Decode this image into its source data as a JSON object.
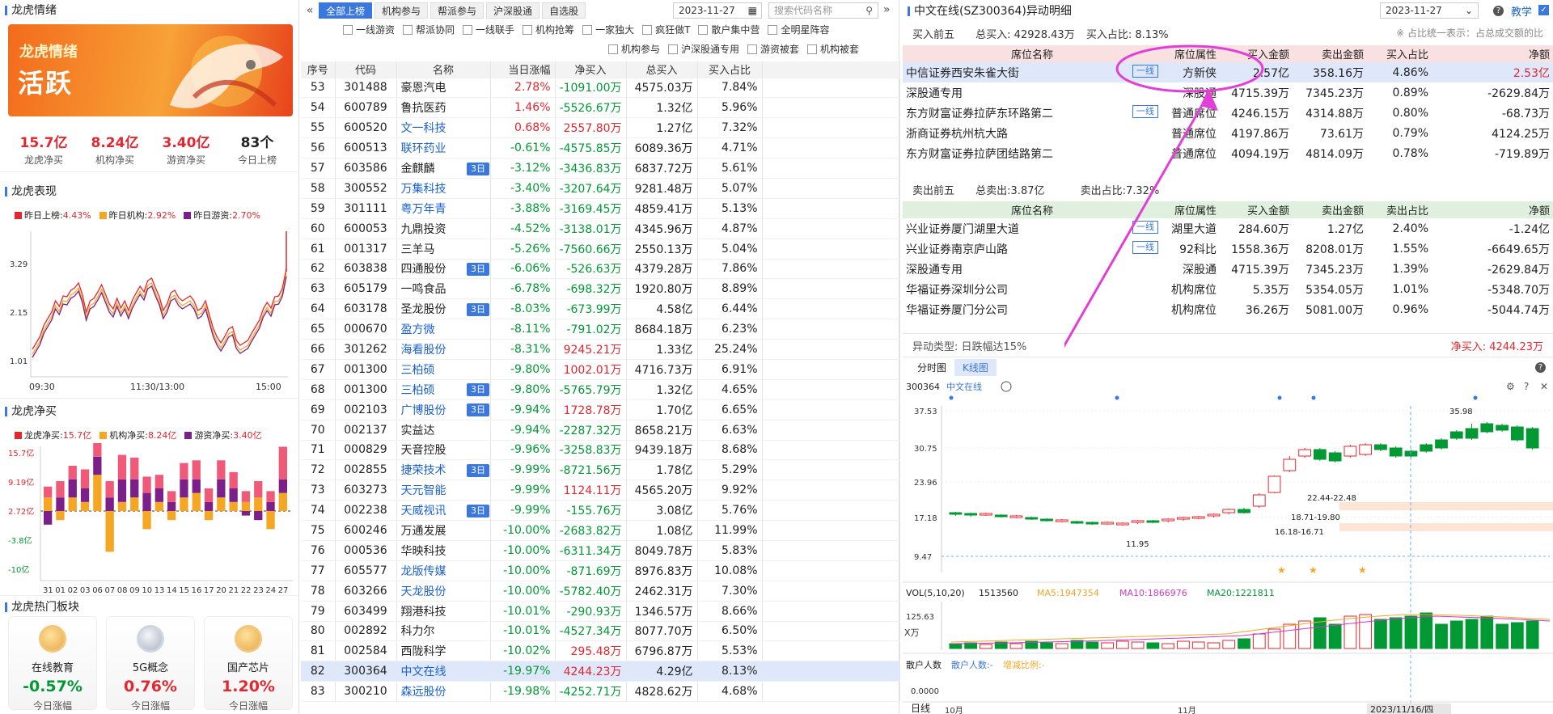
{
  "left": {
    "title": "龙虎情绪",
    "banner_t1": "龙虎情绪",
    "banner_t2": "活跃",
    "stats": [
      {
        "v": "15.7亿",
        "l": "龙虎净买",
        "c": "red"
      },
      {
        "v": "8.24亿",
        "l": "机构净买",
        "c": "red"
      },
      {
        "v": "3.40亿",
        "l": "游资净买",
        "c": "red"
      },
      {
        "v": "83个",
        "l": "今日上榜",
        "c": "dark"
      }
    ],
    "perf_title": "龙虎表现",
    "perf_legend": [
      {
        "n": "昨日上榜:",
        "v": "4.43%",
        "c": "#e4262e"
      },
      {
        "n": "昨日机构:",
        "v": "2.92%",
        "c": "#f5a623"
      },
      {
        "n": "昨日游资:",
        "v": "2.70%",
        "c": "#7b1f8a"
      }
    ],
    "perf_yticks": [
      "3.29",
      "2.15",
      "1.01"
    ],
    "perf_xticks": [
      "09:30",
      "11:30/13:00",
      "15:00"
    ],
    "net_title": "龙虎净买",
    "net_legend": [
      {
        "n": "龙虎净买:",
        "v": "15.7亿",
        "c": "#e4262e"
      },
      {
        "n": "机构净买:",
        "v": "8.24亿",
        "c": "#f5a623"
      },
      {
        "n": "游资净买:",
        "v": "3.40亿",
        "c": "#7b1f8a"
      }
    ],
    "net_yticks": [
      "15.7亿",
      "9.19亿",
      "2.72亿",
      "-3.8亿",
      "-10亿"
    ],
    "net_xticks": [
      "31",
      "01",
      "02",
      "03",
      "06",
      "07",
      "08",
      "09",
      "10",
      "13",
      "14",
      "15",
      "16",
      "17",
      "20",
      "21",
      "22",
      "23",
      "24",
      "27"
    ],
    "hot_title": "龙虎热门板块",
    "plates": [
      {
        "n": "在线教育",
        "p": "-0.57%",
        "c": "green",
        "f": "今日涨幅",
        "m": "g"
      },
      {
        "n": "5G概念",
        "p": "0.76%",
        "c": "red",
        "f": "今日涨幅",
        "m": "s"
      },
      {
        "n": "国产芯片",
        "p": "1.20%",
        "c": "red",
        "f": "今日涨幅",
        "m": "g"
      }
    ]
  },
  "mid": {
    "tabs": [
      "全部上榜",
      "机构参与",
      "帮派参与",
      "沪深股通",
      "自选股"
    ],
    "date": "2023-11-27",
    "search_placeholder": "搜索代码名称",
    "filters_row1": [
      "一线游资",
      "帮派协同",
      "一线联手",
      "机构抢筹",
      "一家独大",
      "疯狂做T",
      "散户集中营",
      "全明星阵容"
    ],
    "filters_row2": [
      "机构参与",
      "沪深股通专用",
      "游资被套",
      "机构被套"
    ],
    "headers": [
      "序号",
      "代码",
      "名称",
      "当日涨幅",
      "净买入",
      "总买入",
      "买入占比"
    ],
    "rows": [
      [
        "53",
        "301488",
        "豪恩汽电",
        "",
        "2.78%",
        "-1091.00万",
        "4575.03万",
        "7.84%"
      ],
      [
        "54",
        "600789",
        "鲁抗医药",
        "",
        "1.46%",
        "-5526.67万",
        "1.32亿",
        "5.96%"
      ],
      [
        "55",
        "600520",
        "文一科技",
        "",
        "0.68%",
        "2557.80万",
        "1.27亿",
        "7.32%"
      ],
      [
        "56",
        "600513",
        "联环药业",
        "",
        "-0.61%",
        "-4575.85万",
        "6089.36万",
        "4.71%"
      ],
      [
        "57",
        "603586",
        "金麒麟",
        "3日",
        "-3.12%",
        "-3436.83万",
        "6837.72万",
        "5.61%"
      ],
      [
        "58",
        "300552",
        "万集科技",
        "",
        "-3.40%",
        "-3207.64万",
        "9281.48万",
        "5.07%"
      ],
      [
        "59",
        "301111",
        "粤万年青",
        "",
        "-3.88%",
        "-3169.45万",
        "4859.41万",
        "5.13%"
      ],
      [
        "60",
        "600053",
        "九鼎投资",
        "",
        "-4.52%",
        "-3138.01万",
        "4345.96万",
        "4.87%"
      ],
      [
        "61",
        "001317",
        "三羊马",
        "",
        "-5.26%",
        "-7560.66万",
        "2550.13万",
        "5.04%"
      ],
      [
        "62",
        "603838",
        "四通股份",
        "3日",
        "-6.06%",
        "-526.63万",
        "4379.28万",
        "7.86%"
      ],
      [
        "63",
        "605179",
        "一鸣食品",
        "",
        "-6.78%",
        "-698.32万",
        "1920.80万",
        "8.89%"
      ],
      [
        "64",
        "603178",
        "圣龙股份",
        "3日",
        "-8.03%",
        "-673.99万",
        "4.58亿",
        "6.44%"
      ],
      [
        "65",
        "000670",
        "盈方微",
        "",
        "-8.11%",
        "-791.02万",
        "8684.18万",
        "6.23%"
      ],
      [
        "66",
        "301262",
        "海看股份",
        "",
        "-8.31%",
        "9245.21万",
        "1.33亿",
        "25.24%"
      ],
      [
        "67",
        "001300",
        "三柏硕",
        "",
        "-9.80%",
        "1002.01万",
        "4716.73万",
        "6.91%"
      ],
      [
        "68",
        "001300",
        "三柏硕",
        "3日",
        "-9.80%",
        "-5765.79万",
        "1.32亿",
        "4.65%"
      ],
      [
        "69",
        "002103",
        "广博股份",
        "3日",
        "-9.94%",
        "1728.78万",
        "1.70亿",
        "6.65%"
      ],
      [
        "70",
        "002137",
        "实益达",
        "",
        "-9.94%",
        "-2287.32万",
        "8658.21万",
        "6.63%"
      ],
      [
        "71",
        "000829",
        "天音控股",
        "",
        "-9.96%",
        "-3258.83万",
        "9439.18万",
        "8.68%"
      ],
      [
        "72",
        "002855",
        "捷荣技术",
        "3日",
        "-9.99%",
        "-8721.56万",
        "1.78亿",
        "5.29%"
      ],
      [
        "73",
        "603273",
        "天元智能",
        "",
        "-9.99%",
        "1124.11万",
        "4565.20万",
        "9.92%"
      ],
      [
        "74",
        "002238",
        "天威视讯",
        "3日",
        "-9.99%",
        "-155.76万",
        "3.08亿",
        "5.76%"
      ],
      [
        "75",
        "600246",
        "万通发展",
        "",
        "-10.00%",
        "-2683.82万",
        "1.08亿",
        "11.99%"
      ],
      [
        "76",
        "000536",
        "华映科技",
        "",
        "-10.00%",
        "-6311.34万",
        "8049.78万",
        "5.83%"
      ],
      [
        "77",
        "605577",
        "龙版传媒",
        "",
        "-10.00%",
        "-871.69万",
        "8976.83万",
        "10.08%"
      ],
      [
        "78",
        "603266",
        "天龙股份",
        "",
        "-10.00%",
        "-5782.40万",
        "2462.31万",
        "7.30%"
      ],
      [
        "79",
        "603499",
        "翔港科技",
        "",
        "-10.01%",
        "-290.93万",
        "1346.57万",
        "8.66%"
      ],
      [
        "80",
        "002892",
        "科力尔",
        "",
        "-10.01%",
        "-4527.34万",
        "8077.70万",
        "6.50%"
      ],
      [
        "81",
        "002584",
        "西陇科学",
        "",
        "-10.02%",
        "295.48万",
        "6796.87万",
        "5.53%"
      ],
      [
        "82",
        "300364",
        "中文在线",
        "",
        "-19.97%",
        "4244.23万",
        "4.29亿",
        "8.13%"
      ],
      [
        "83",
        "300210",
        "森远股份",
        "",
        "-19.98%",
        "-4252.71万",
        "4828.62万",
        "4.68%"
      ]
    ],
    "blue_names": [
      "文一科技",
      "联环药业",
      "万集科技",
      "粤万年青",
      "盈方微",
      "海看股份",
      "三柏硕",
      "广博股份",
      "捷荣技术",
      "天元智能",
      "天威视讯",
      "龙版传媒",
      "天龙股份",
      "中文在线",
      "森远股份"
    ],
    "selected_row": "82"
  },
  "right": {
    "title": "中文在线(SZ300364)异动明细",
    "date": "2023-11-27",
    "teach": "教学",
    "buy_label": "买入前五",
    "buy_total": "总买入: 42928.43万",
    "buy_ratio": "买入占比: 8.13%",
    "note": "※ 占比统一表示：占总成交额的比",
    "buy_headers": [
      "席位名称",
      "席位属性",
      "买入金额",
      "卖出金额",
      "买入占比",
      "净额"
    ],
    "buy_rows": [
      {
        "name": "中信证券西安朱雀大街",
        "tag": "一线",
        "attr": "方新侠",
        "buy": "2.57亿",
        "sell": "358.16万",
        "ratio": "4.86%",
        "net": "2.53亿",
        "nc": "red"
      },
      {
        "name": "深股通专用",
        "tag": "",
        "attr": "深股通",
        "buy": "4715.39万",
        "sell": "7345.23万",
        "ratio": "0.89%",
        "net": "-2629.84万",
        "nc": "dark"
      },
      {
        "name": "东方财富证券拉萨东环路第二",
        "tag": "一线",
        "attr": "普通席位",
        "buy": "4246.15万",
        "sell": "4314.88万",
        "ratio": "0.80%",
        "net": "-68.73万",
        "nc": "dark"
      },
      {
        "name": "浙商证券杭州杭大路",
        "tag": "",
        "attr": "普通席位",
        "buy": "4197.86万",
        "sell": "73.61万",
        "ratio": "0.79%",
        "net": "4124.25万",
        "nc": "dark"
      },
      {
        "name": "东方财富证券拉萨团结路第二",
        "tag": "",
        "attr": "普通席位",
        "buy": "4094.19万",
        "sell": "4814.09万",
        "ratio": "0.78%",
        "net": "-719.89万",
        "nc": "dark"
      }
    ],
    "sell_label": "卖出前五",
    "sell_total": "总卖出:3.87亿",
    "sell_ratio": "卖出占比:7.32%",
    "sell_headers": [
      "席位名称",
      "席位属性",
      "买入金额",
      "卖出金额",
      "卖出占比",
      "净额"
    ],
    "sell_rows": [
      {
        "name": "兴业证券厦门湖里大道",
        "tag": "一线",
        "attr": "湖里大道",
        "buy": "284.60万",
        "sell": "1.27亿",
        "ratio": "2.40%",
        "net": "-1.24亿"
      },
      {
        "name": "兴业证券南京庐山路",
        "tag": "一线",
        "attr": "92科比",
        "buy": "1558.36万",
        "sell": "8208.01万",
        "ratio": "1.55%",
        "net": "-6649.65万"
      },
      {
        "name": "深股通专用",
        "tag": "",
        "attr": "深股通",
        "buy": "4715.39万",
        "sell": "7345.23万",
        "ratio": "1.39%",
        "net": "-2629.84万"
      },
      {
        "name": "华福证券深圳分公司",
        "tag": "",
        "attr": "机构席位",
        "buy": "5.35万",
        "sell": "5354.05万",
        "ratio": "1.01%",
        "net": "-5348.70万"
      },
      {
        "name": "华福证券厦门分公司",
        "tag": "",
        "attr": "机构席位",
        "buy": "36.26万",
        "sell": "5081.00万",
        "ratio": "0.96%",
        "net": "-5044.74万"
      }
    ],
    "anomaly": "异动类型: 日跌幅达15%",
    "net_buy": "净买入: 4244.23万",
    "chart_tabs": [
      "分时图",
      "K线图"
    ],
    "stock_code": "300364",
    "stock_name": "中文在线",
    "price_ticks": [
      "37.53",
      "30.75",
      "23.96",
      "17.18",
      "9.47"
    ],
    "annotations": [
      "35.98",
      "22.44-22.48",
      "18.71-19.80",
      "16.18-16.71",
      "11.95"
    ],
    "vol_label": "VOL(5,10,20)",
    "vol_val": "1513560",
    "ma5": "MA5:1947354",
    "ma10": "MA10:1866976",
    "ma20": "MA20:1221811",
    "vol_ticks": [
      "125.63",
      "X万"
    ],
    "retail_label": "散户人数",
    "retail_val": "散户人数:-",
    "retail_change": "增减比例:-",
    "retail_tick": "0.0000",
    "xaxis": [
      "日线",
      "10月",
      "11月",
      "2023/11/16/四"
    ]
  }
}
